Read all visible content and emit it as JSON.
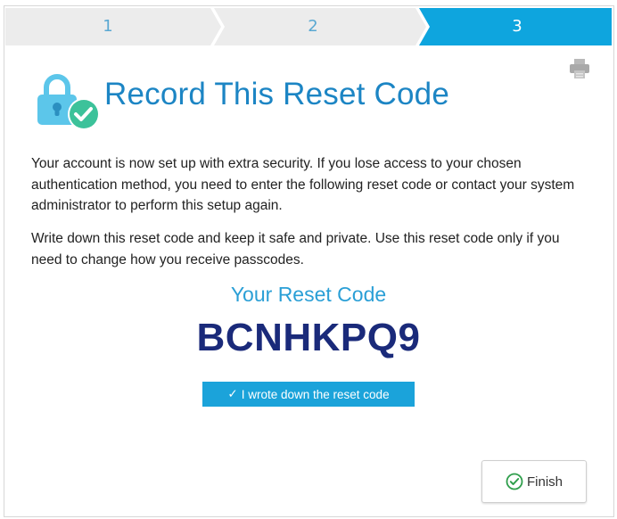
{
  "stepper": {
    "steps": [
      {
        "label": "1",
        "active": false
      },
      {
        "label": "2",
        "active": false
      },
      {
        "label": "3",
        "active": true
      }
    ],
    "colors": {
      "inactive_fill": "#ececec",
      "active_fill": "#0ea5de",
      "inactive_text": "#5aa8d2",
      "active_text": "#ffffff"
    }
  },
  "header": {
    "title": "Record This Reset Code",
    "icon": "lock-check-icon",
    "print_icon": "print-icon"
  },
  "content": {
    "paragraph1": "Your account is now set up with extra security. If you lose access to your chosen authentication method, you need to enter the following reset code or contact your system administrator to perform this setup again.",
    "paragraph2": "Write down this reset code and keep it safe and private. Use this reset code only if you need to change how you receive passcodes.",
    "reset_heading": "Your Reset Code",
    "reset_code": "BCNHKPQ9"
  },
  "actions": {
    "ack_label": "I wrote down the reset code",
    "ack_check": "✓",
    "finish_label": "Finish"
  },
  "colors": {
    "title": "#1c85c4",
    "reset_heading": "#2a9fd6",
    "reset_code": "#1a2a7a",
    "ack_button": "#1ba3da",
    "lock_body": "#5cc6ea",
    "badge": "#3cc29a"
  }
}
